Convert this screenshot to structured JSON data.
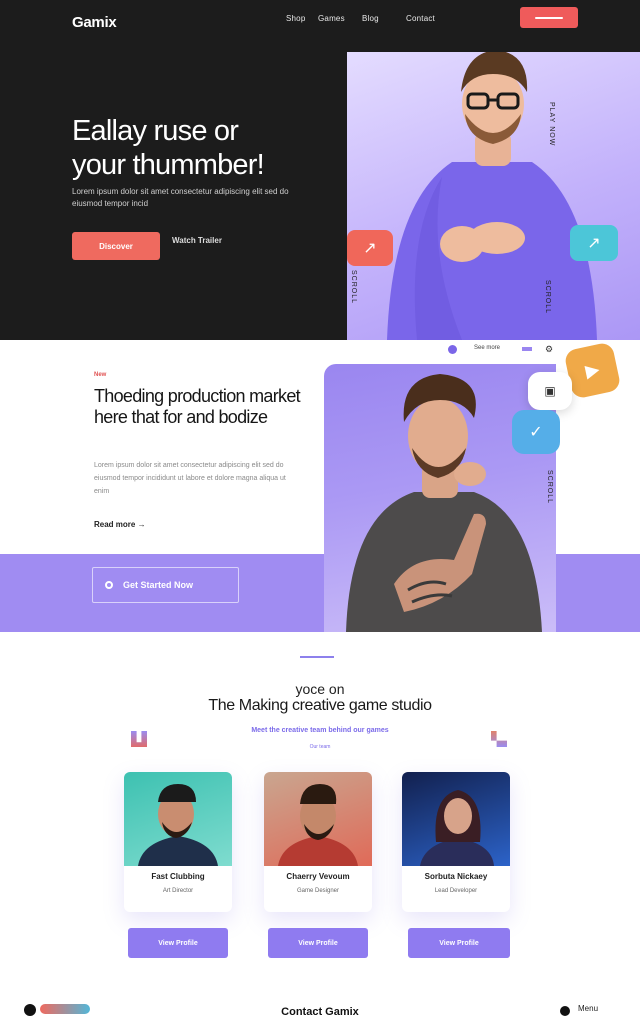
{
  "nav": {
    "logo": "Gamix",
    "links": [
      "Shop",
      "Games",
      "Blog",
      "Contact"
    ],
    "cta_label": ""
  },
  "hero": {
    "title_line1": "Eallay ruse or",
    "title_line2": "your thummber!",
    "subtitle": "Lorem ipsum dolor sit amet consectetur adipiscing elit sed do eiusmod tempor incid",
    "primary_button": "Discover",
    "secondary_link": "Watch Trailer",
    "side_text_top": "PLAY NOW",
    "side_text_bottom": "SCROLL"
  },
  "features": {
    "tag": "New",
    "title": "Thoeding production market here that for and bodize",
    "body": "Lorem ipsum dolor sit amet consectetur adipiscing elit sed do eiusmod tempor incididunt ut labore et dolore magna aliqua ut enim",
    "link": "Read more →",
    "band_button": "Get Started Now",
    "mini_label": "See more"
  },
  "team": {
    "subtitle": "yoce on",
    "title": "The Making creative game studio",
    "blurb": "Meet the creative team behind our games",
    "tiny": "Our team",
    "cards": [
      {
        "name": "Fast Clubbing",
        "role": "Art Director",
        "button": "View Profile",
        "color_a": "#2fb8a8",
        "color_b": "#7fdccf"
      },
      {
        "name": "Chaerry Vevoum",
        "role": "Game Designer",
        "button": "View Profile",
        "color_a": "#b86a4e",
        "color_b": "#d95a4a"
      },
      {
        "name": "Sorbuta Nickaey",
        "role": "Lead Developer",
        "button": "View Profile",
        "color_a": "#1a2a6a",
        "color_b": "#3a6ad8"
      }
    ]
  },
  "footer": {
    "center_text": "Contact Gamix",
    "right_text": "Menu"
  }
}
